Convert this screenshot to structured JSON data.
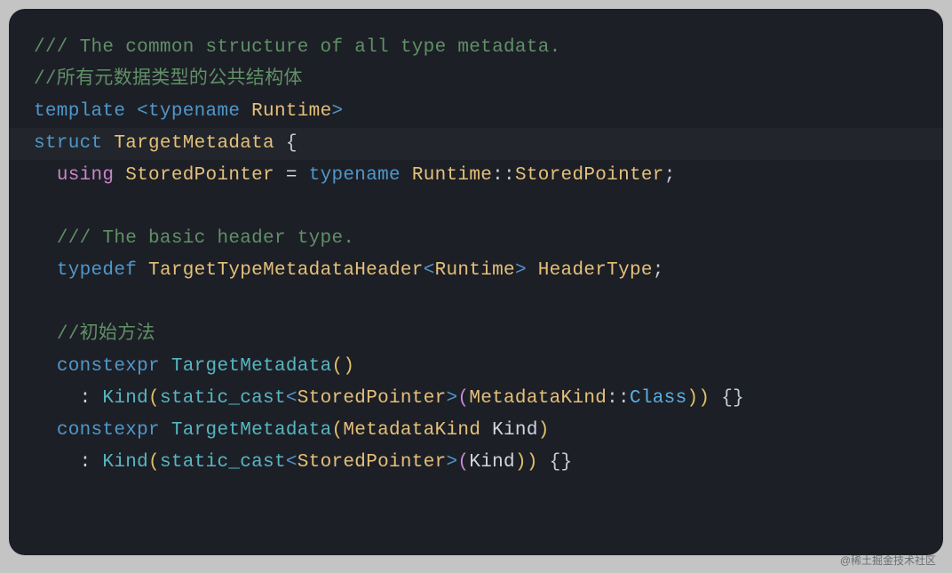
{
  "code": {
    "l1": {
      "t1": "/// The common structure of all type metadata."
    },
    "l2": {
      "t1": "//所有元数据类型的公共结构体"
    },
    "l3": {
      "k1": "template",
      "a1": " <",
      "k2": "typename",
      "sp": " ",
      "t1": "Runtime",
      "a2": ">"
    },
    "l4": {
      "k1": "struct",
      "sp": " ",
      "t1": "TargetMetadata",
      "sp2": " ",
      "b1": "{"
    },
    "l5": {
      "ind": "  ",
      "k1": "using",
      "sp": " ",
      "t1": "StoredPointer",
      "sp2": " ",
      "eq": "=",
      "sp3": " ",
      "k2": "typename",
      "sp4": " ",
      "t2": "Runtime",
      "sc": "::",
      "t3": "StoredPointer",
      "semi": ";"
    },
    "l6": {
      "t1": ""
    },
    "l7": {
      "ind": "  ",
      "t1": "/// The basic header type."
    },
    "l8": {
      "ind": "  ",
      "k1": "typedef",
      "sp": " ",
      "t1": "TargetTypeMetadataHeader",
      "a1": "<",
      "t2": "Runtime",
      "a2": ">",
      "sp2": " ",
      "t3": "HeaderType",
      "semi": ";"
    },
    "l9": {
      "t1": ""
    },
    "l10": {
      "ind": "  ",
      "t1": "//初始方法"
    },
    "l11": {
      "ind": "  ",
      "k1": "constexpr",
      "sp": " ",
      "f1": "TargetMetadata",
      "p1": "()"
    },
    "l12": {
      "ind": "    ",
      "colon": ":",
      "sp": " ",
      "f1": "Kind",
      "p1": "(",
      "f2": "static_cast",
      "a1": "<",
      "t1": "StoredPointer",
      "a2": ">",
      "p2": "(",
      "t2": "MetadataKind",
      "sc": "::",
      "t3": "Class",
      "p3": "))",
      "sp2": " ",
      "b1": "{}"
    },
    "l13": {
      "ind": "  ",
      "k1": "constexpr",
      "sp": " ",
      "f1": "TargetMetadata",
      "p1": "(",
      "t1": "MetadataKind",
      "sp2": " ",
      "v1": "Kind",
      "p2": ")"
    },
    "l14": {
      "ind": "    ",
      "colon": ":",
      "sp": " ",
      "f1": "Kind",
      "p1": "(",
      "f2": "static_cast",
      "a1": "<",
      "t1": "StoredPointer",
      "a2": ">",
      "p2": "(",
      "v1": "Kind",
      "p3": "))",
      "sp2": " ",
      "b1": "{}"
    }
  },
  "watermark": "@稀土掘金技术社区"
}
